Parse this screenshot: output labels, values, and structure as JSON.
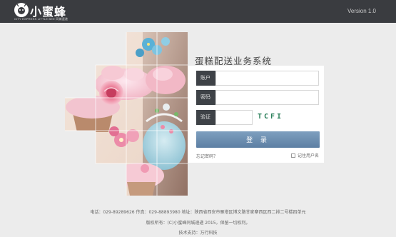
{
  "header": {
    "logo_text": "小蜜蜂",
    "logo_sub": "CITY EXPRESS LITTLE BEE 同城速递",
    "version": "Version 1.0"
  },
  "login": {
    "title": "蛋糕配送业务系统",
    "account_label": "账户",
    "password_label": "密码",
    "captcha_label": "验证",
    "captcha_code": "TCFI",
    "account_value": "",
    "password_value": "",
    "captcha_value": "",
    "submit_label": "登 录",
    "forgot_label": "忘记密码？",
    "remember_label": "记住用户名",
    "remember_checked": false
  },
  "footer": {
    "contact": "电话：029-89289626   传真：029-88893980   地址：陕西省西安市雁塔区博文路甘家寨西区西二排二号楼四单元",
    "copyright": "版权所有：(C)小蜜蜂同城速递 2015，保留一切权利。",
    "support": "技术支持：万行科技"
  },
  "colors": {
    "header_bg": "#3a3c40",
    "label_bg": "#3e4247",
    "button": "#6e8fb2",
    "captcha": "#2a7f5a",
    "page_bg": "#ececec"
  }
}
